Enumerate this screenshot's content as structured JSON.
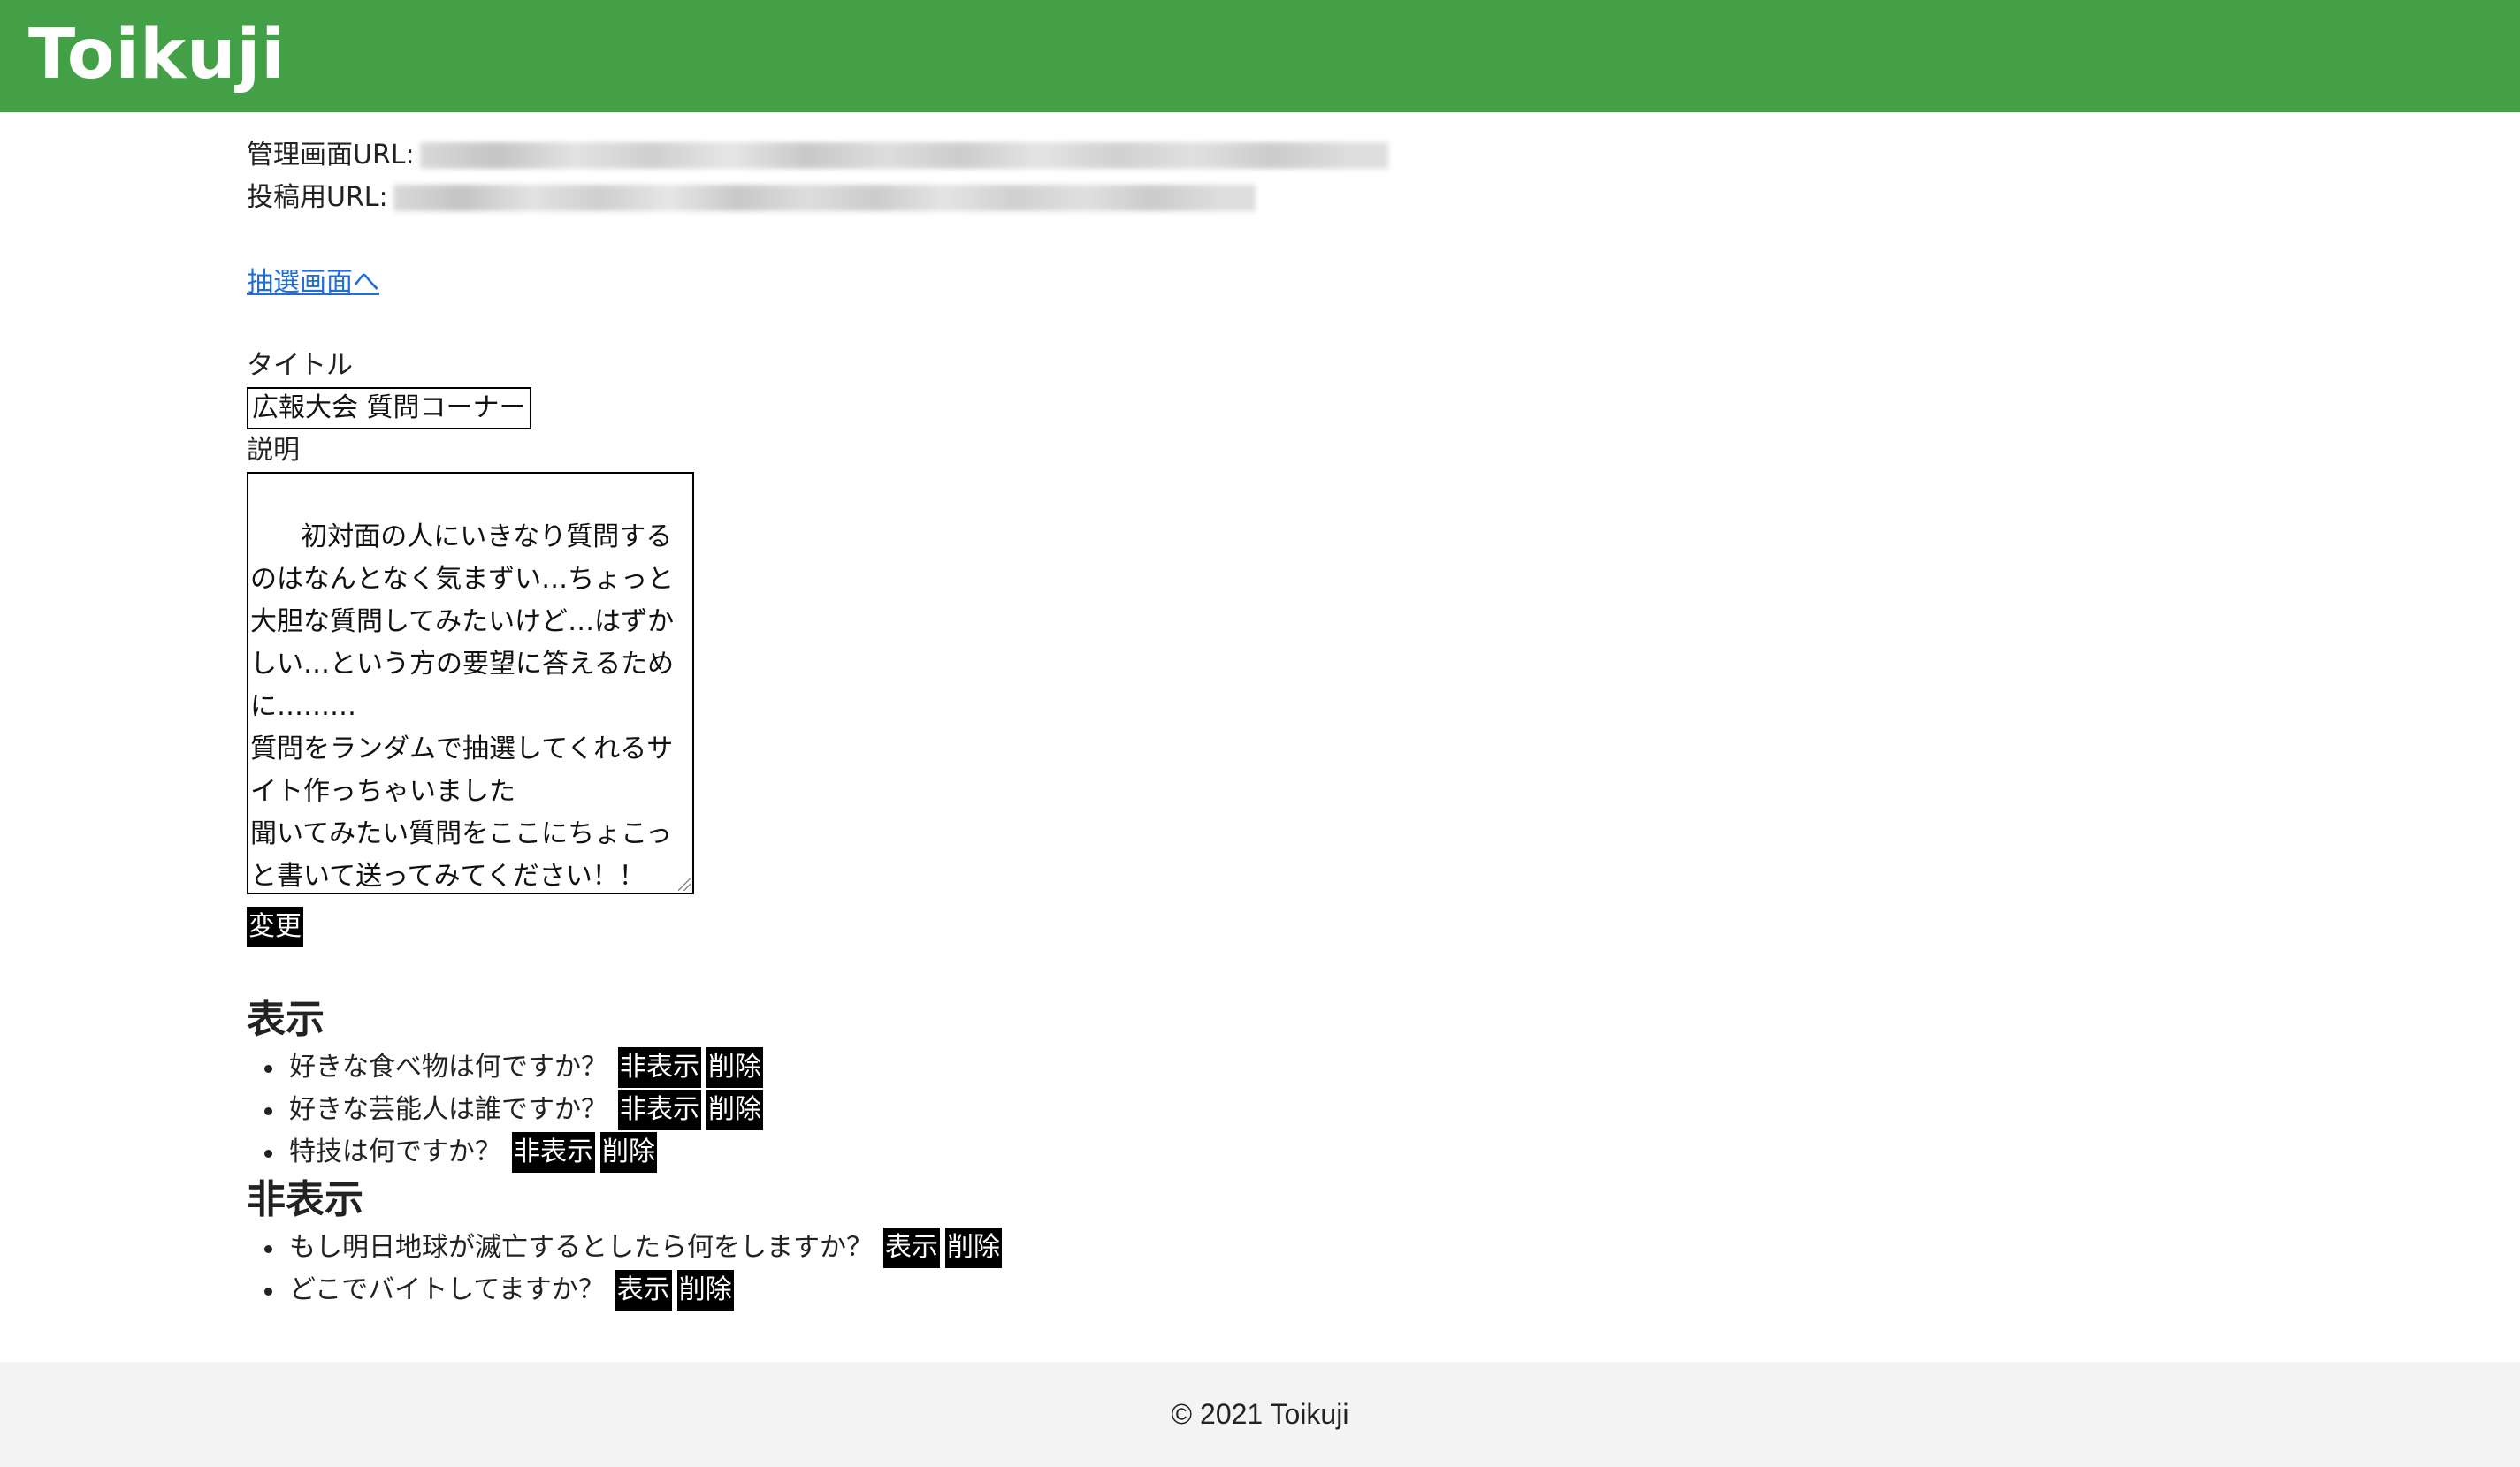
{
  "header": {
    "logo": "Toikuji",
    "color": "#43a047"
  },
  "urls": {
    "admin_label": "管理画面URL:",
    "post_label": "投稿用URL:"
  },
  "draw_link": "抽選画面へ",
  "form": {
    "title_label": "タイトル",
    "title_value": "広報大会 質問コーナー",
    "description_label": "説明",
    "description_value": "初対面の人にいきなり質問するのはなんとなく気まずい…ちょっと大胆な質問してみたいけど…はずかしい…という方の要望に答えるために………\n質問をランダムで抽選してくれるサイト作っちゃいました\n聞いてみたい質問をここにちょこっと書いて送ってみてください！！\nそしたら回答者がランダムで皆から",
    "change_button": "変更"
  },
  "shown_section": {
    "heading": "表示",
    "items": [
      {
        "question": "好きな食べ物は何ですか？",
        "toggle_label": "非表示",
        "delete_label": "削除"
      },
      {
        "question": "好きな芸能人は誰ですか？",
        "toggle_label": "非表示",
        "delete_label": "削除"
      },
      {
        "question": "特技は何ですか？",
        "toggle_label": "非表示",
        "delete_label": "削除"
      }
    ]
  },
  "hidden_section": {
    "heading": "非表示",
    "items": [
      {
        "question": "もし明日地球が滅亡するとしたら何をしますか？",
        "toggle_label": "表示",
        "delete_label": "削除"
      },
      {
        "question": "どこでバイトしてますか？",
        "toggle_label": "表示",
        "delete_label": "削除"
      }
    ]
  },
  "footer": {
    "copyright": "© 2021 Toikuji"
  }
}
